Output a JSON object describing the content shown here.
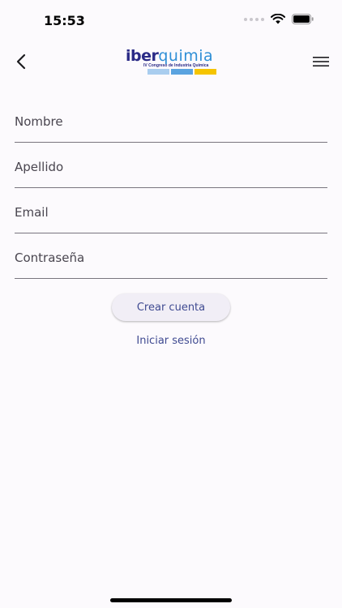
{
  "status_bar": {
    "time": "15:53"
  },
  "app_bar": {
    "logo": {
      "word_main": "iber",
      "word_accent": "quimia",
      "subtitle": "IV Congreso de Industria Química",
      "bar_colors": [
        "#a9cdef",
        "#5aa3e0",
        "#f5c400"
      ]
    }
  },
  "form": {
    "first_name": {
      "placeholder": "Nombre",
      "value": ""
    },
    "last_name": {
      "placeholder": "Apellido",
      "value": ""
    },
    "email": {
      "placeholder": "Email",
      "value": ""
    },
    "password": {
      "placeholder": "Contraseña",
      "value": ""
    }
  },
  "actions": {
    "create_account_label": "Crear cuenta",
    "login_link_label": "Iniciar sesión"
  },
  "colors": {
    "background": "#fcfafd",
    "accent": "#3f4a91",
    "button_fill": "#f1eef6"
  },
  "icons": {
    "back": "chevron-left-icon",
    "menu": "hamburger-menu-icon",
    "wifi": "wifi-icon",
    "battery": "battery-icon"
  }
}
